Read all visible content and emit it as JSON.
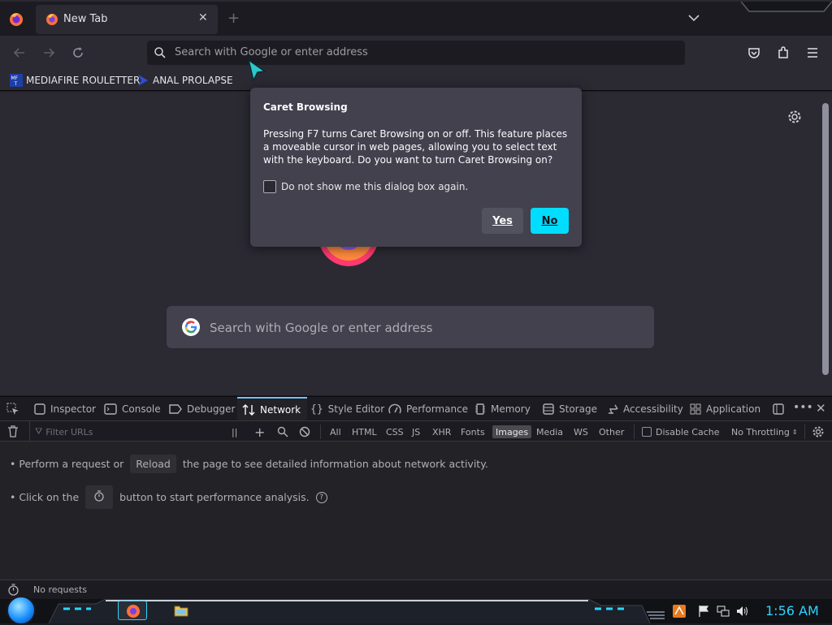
{
  "tab": {
    "title": "New Tab"
  },
  "urlbar": {
    "placeholder": "Search with Google or enter address"
  },
  "bookmarks": [
    {
      "label": "MEDIAFIRE ROULETTER",
      "icon": "mediafire-icon"
    },
    {
      "label": "ANAL PROLAPSE",
      "icon": "bookmark-icon"
    }
  ],
  "newtab": {
    "search_placeholder": "Search with Google or enter address"
  },
  "dialog": {
    "title": "Caret Browsing",
    "body": "Pressing F7 turns Caret Browsing on or off. This feature places a moveable cursor in web pages, allowing you to select text with the keyboard. Do you want to turn Caret Browsing on?",
    "checkbox_label": "Do not show me this dialog box again.",
    "yes_label": "Yes",
    "no_label": "No"
  },
  "devtools": {
    "tabs": [
      {
        "label": "Inspector",
        "icon": "inspector-icon"
      },
      {
        "label": "Console",
        "icon": "console-icon"
      },
      {
        "label": "Debugger",
        "icon": "debugger-icon"
      },
      {
        "label": "Network",
        "icon": "network-icon",
        "selected": true
      },
      {
        "label": "Style Editor",
        "icon": "style-editor-icon"
      },
      {
        "label": "Performance",
        "icon": "performance-icon"
      },
      {
        "label": "Memory",
        "icon": "memory-icon"
      },
      {
        "label": "Storage",
        "icon": "storage-icon"
      },
      {
        "label": "Accessibility",
        "icon": "accessibility-icon"
      },
      {
        "label": "Application",
        "icon": "application-icon"
      }
    ],
    "filter_placeholder": "Filter URLs",
    "filters": [
      "All",
      "HTML",
      "CSS",
      "JS",
      "XHR",
      "Fonts",
      "Images",
      "Media",
      "WS",
      "Other"
    ],
    "selected_filter": "Images",
    "disable_cache_label": "Disable Cache",
    "throttling": "No Throttling",
    "msg1_before": "• Perform a request or",
    "msg1_button": "Reload",
    "msg1_after": "the page to see detailed information about network activity.",
    "msg2_before": "• Click on the",
    "msg2_after": "button to start performance analysis.",
    "status": "No requests"
  },
  "taskbar": {
    "clock": "1:56 AM"
  },
  "colors": {
    "accent": "#00ddff",
    "devtools_selected": "#75bfff",
    "clock": "#2fd3ff"
  }
}
